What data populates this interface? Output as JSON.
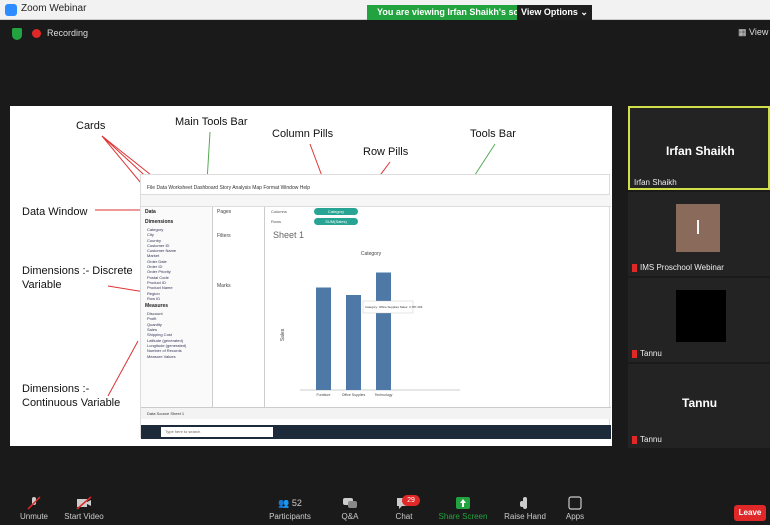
{
  "window": {
    "title": "Zoom Webinar"
  },
  "banner": {
    "message": "You are viewing Irfan Shaikh's screen",
    "options_label": "View Options ⌄"
  },
  "recording": {
    "label": "Recording"
  },
  "view": {
    "label": "View"
  },
  "shared": {
    "annotations": {
      "cards": "Cards",
      "main_tools_bar": "Main Tools Bar",
      "column_pills": "Column Pills",
      "row_pills": "Row Pills",
      "tools_bar": "Tools Bar",
      "data_window": "Data Window",
      "dimensions_discrete": "Dimensions :- Discrete Variable",
      "dimensions_continuous": "Dimensions :- Continuous Variable"
    },
    "tableau": {
      "menu": "File  Data  Worksheet  Dashboard  Story  Analysis  Map  Format  Window  Help",
      "data_header": "Data",
      "dimensions_header": "Dimensions",
      "dimensions": [
        "Category",
        "City",
        "Country",
        "Customer ID",
        "Customer Name",
        "Market",
        "Order Date",
        "Order ID",
        "Order Priority",
        "Postal Code",
        "Product ID",
        "Product Name",
        "Region",
        "Row ID"
      ],
      "measures_header": "Measures",
      "measures": [
        "Discount",
        "Profit",
        "Quantity",
        "Sales",
        "Shipping Cost",
        "Latitude (generated)",
        "Longitude (generated)",
        "Number of Records",
        "Measure Values"
      ],
      "shelves": {
        "pages": "Pages",
        "filters": "Filters",
        "marks": "Marks"
      },
      "columns_label": "Columns",
      "columns_pill": "Category",
      "rows_label": "Rows",
      "rows_pill": "SUM(Sales)",
      "sheet_title": "Sheet 1",
      "status": "Data Source   Sheet 1",
      "taskbar_search": "Type here to search"
    }
  },
  "chart_data": {
    "type": "bar",
    "title": "Category",
    "categories": [
      "Furniture",
      "Office Supplies",
      "Technology"
    ],
    "values": [
      4100000,
      3800000,
      4700000
    ],
    "ylabel": "Sales",
    "ylim": [
      0,
      5000000
    ],
    "tooltip": "Category: Office Supplies  Sales: 3,787,493",
    "bar_color": "#4e79a7"
  },
  "participants_panels": [
    {
      "name": "Irfan Shaikh",
      "label": "Irfan Shaikh"
    },
    {
      "initial": "I",
      "label": "IMS Proschool Webinar"
    },
    {
      "label": "Tannu"
    },
    {
      "name": "Tannu",
      "label": "Tannu"
    }
  ],
  "controls": {
    "unmute": "Unmute",
    "start_video": "Start Video",
    "participants": "Participants",
    "participants_count": "52",
    "qa": "Q&A",
    "chat": "Chat",
    "chat_badge": "29",
    "share_screen": "Share Screen",
    "raise_hand": "Raise Hand",
    "apps": "Apps",
    "leave": "Leave"
  },
  "colors": {
    "accent_green": "#23a33f",
    "leave_red": "#e02828",
    "teal_pill": "#28a495"
  }
}
